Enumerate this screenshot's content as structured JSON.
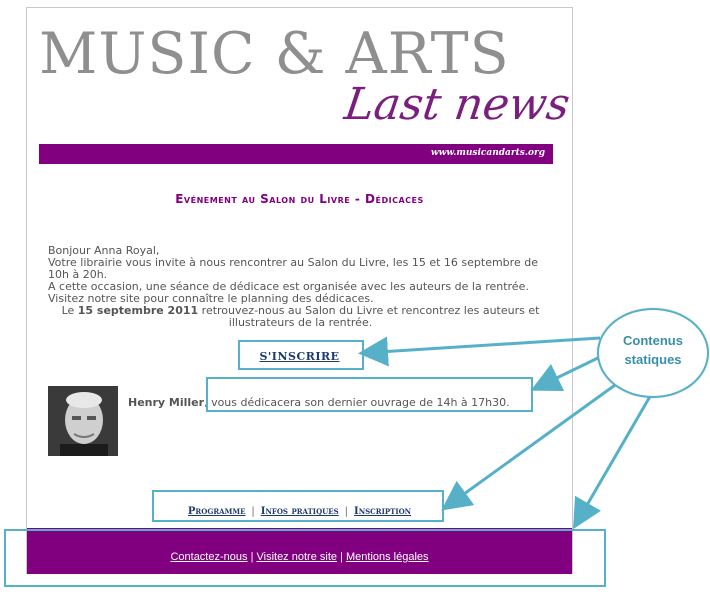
{
  "masthead": {
    "title": "MUSIC & ARTS",
    "subtitle": "Last news",
    "url": "www.musicandarts.org"
  },
  "event": {
    "title": "Evénement au Salon du Livre - Dédicaces"
  },
  "body": {
    "greeting": "Bonjour Anna Royal,",
    "line1": "Votre librairie vous invite à nous rencontrer au Salon du Livre, les 15 et 16 septembre de 10h à 20h.",
    "line2": "A cette occasion, une séance de dédicace est organisée avec les auteurs de la rentrée.",
    "line3": "Visitez notre site pour connaître le planning des dédicaces.",
    "highlight_prefix": "Le ",
    "highlight_date": "15 septembre 2011",
    "highlight_rest": " retrouvez-nous au Salon du Livre et rencontrez les auteurs et illustrateurs de la rentrée."
  },
  "cta": {
    "label": "S'INSCRIRE"
  },
  "author": {
    "name": "Henry Miller",
    "text": ", vous dédicacera son dernier ouvrage de 14h à 17h30."
  },
  "nav": {
    "items": [
      "Programme",
      "Infos pratiques",
      "Inscription"
    ],
    "separator": "|"
  },
  "footer": {
    "links": [
      "Contactez-nous",
      "Visitez notre site",
      "Mentions légales"
    ],
    "separator": "|"
  },
  "callout": {
    "line1": "Contenus",
    "line2": "statiques"
  },
  "colors": {
    "brand_purple": "#800080",
    "masthead_gray": "#8f8f8f",
    "link_blue": "#1d3a6e",
    "callout_blue": "#55b0c8"
  }
}
